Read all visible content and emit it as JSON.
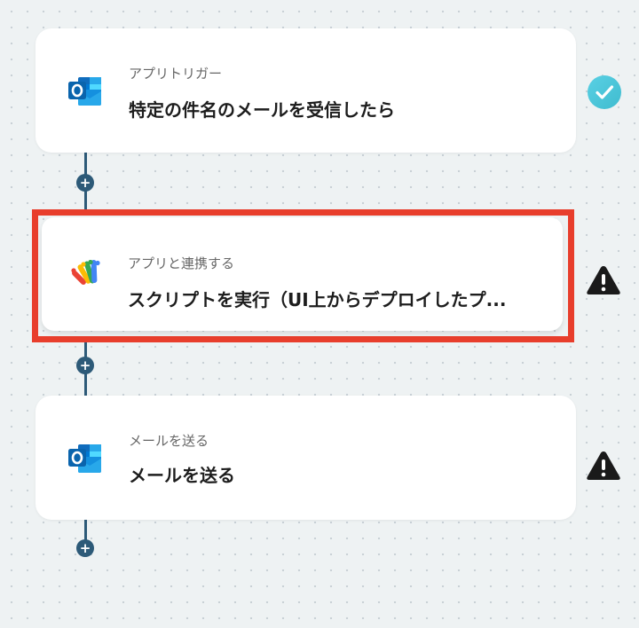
{
  "steps": [
    {
      "subtitle": "アプリトリガー",
      "title": "特定の件名のメールを受信したら",
      "app_icon": "outlook-icon",
      "status_icon": "check-icon",
      "status_color": "#47c9d9"
    },
    {
      "subtitle": "アプリと連携する",
      "title": "スクリプトを実行（UI上からデプロイしたプ...",
      "app_icon": "google-apps-script-icon",
      "status_icon": "warning-icon",
      "status_color": "#1a1a1a",
      "selected": true,
      "highlight_color": "#e83e2c"
    },
    {
      "subtitle": "メールを送る",
      "title": "メールを送る",
      "app_icon": "outlook-icon",
      "status_icon": "warning-icon",
      "status_color": "#1a1a1a"
    }
  ],
  "add_step_label": "+",
  "connector_color": "#2d5a78"
}
